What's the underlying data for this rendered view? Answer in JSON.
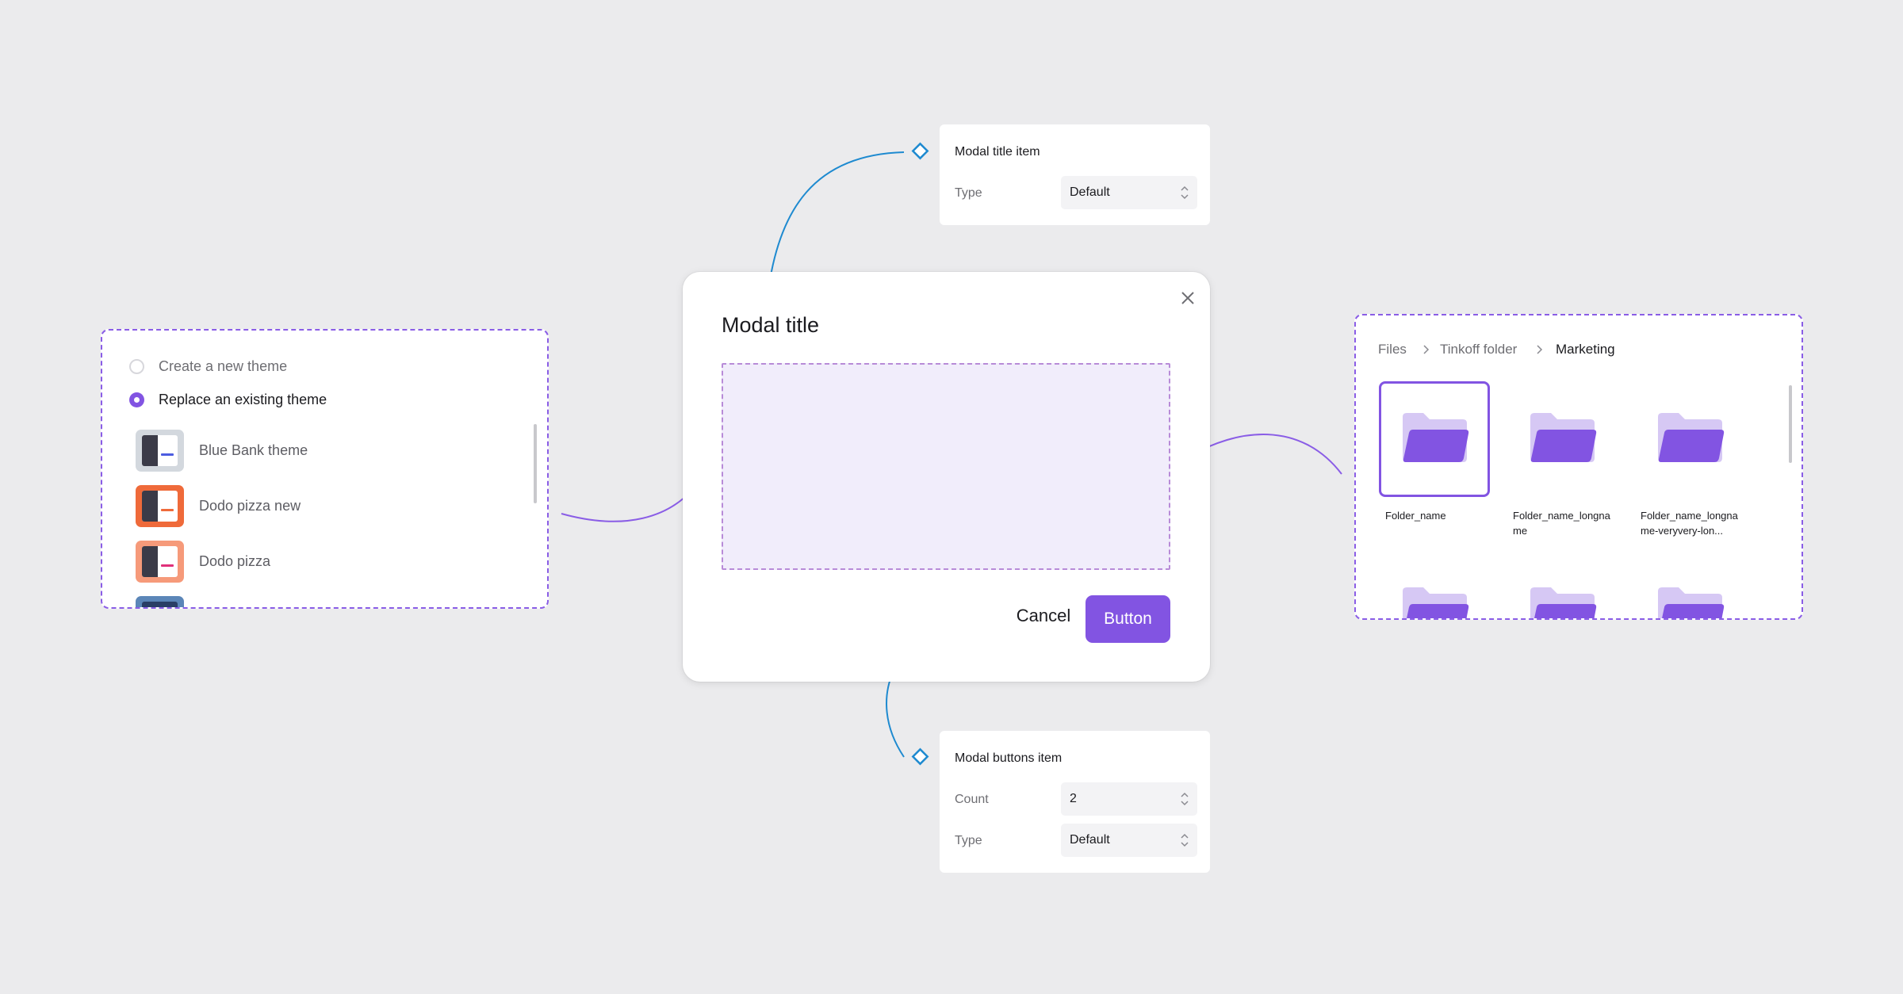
{
  "colors": {
    "background": "#ebebed",
    "accent": "#8254e2",
    "connector_blue": "#1e8ad0",
    "connector_purple": "#8a5de6",
    "slot_fill": "#f1edfb"
  },
  "modal": {
    "title": "Modal title",
    "close_icon": "close-icon",
    "cancel_label": "Cancel",
    "primary_label": "Button"
  },
  "title_props": {
    "heading": "Modal title item",
    "rows": [
      {
        "label": "Type",
        "value": "Default"
      }
    ]
  },
  "buttons_props": {
    "heading": "Modal buttons item",
    "rows": [
      {
        "label": "Count",
        "value": "2"
      },
      {
        "label": "Type",
        "value": "Default"
      }
    ]
  },
  "theme_panel": {
    "options": [
      {
        "label": "Create a new theme",
        "checked": false
      },
      {
        "label": "Replace an existing theme",
        "checked": true
      }
    ],
    "themes": [
      {
        "name": "Blue Bank theme",
        "thumb_color": "#d3d8de",
        "line_color": "#4c5ce0"
      },
      {
        "name": "Dodo pizza new",
        "thumb_color": "#ef6a3a",
        "line_color": "#ef6a3a"
      },
      {
        "name": "Dodo pizza",
        "thumb_color": "#f69a7a",
        "line_color": "#e0307a"
      }
    ]
  },
  "files_panel": {
    "breadcrumbs": [
      "Files",
      "Tinkoff folder",
      "Marketing"
    ],
    "folders": [
      {
        "name": "Folder_name",
        "selected": true
      },
      {
        "name": "Folder_name_longname",
        "selected": false
      },
      {
        "name": "Folder_name_longname-veryvery-lon...",
        "selected": false
      }
    ]
  }
}
